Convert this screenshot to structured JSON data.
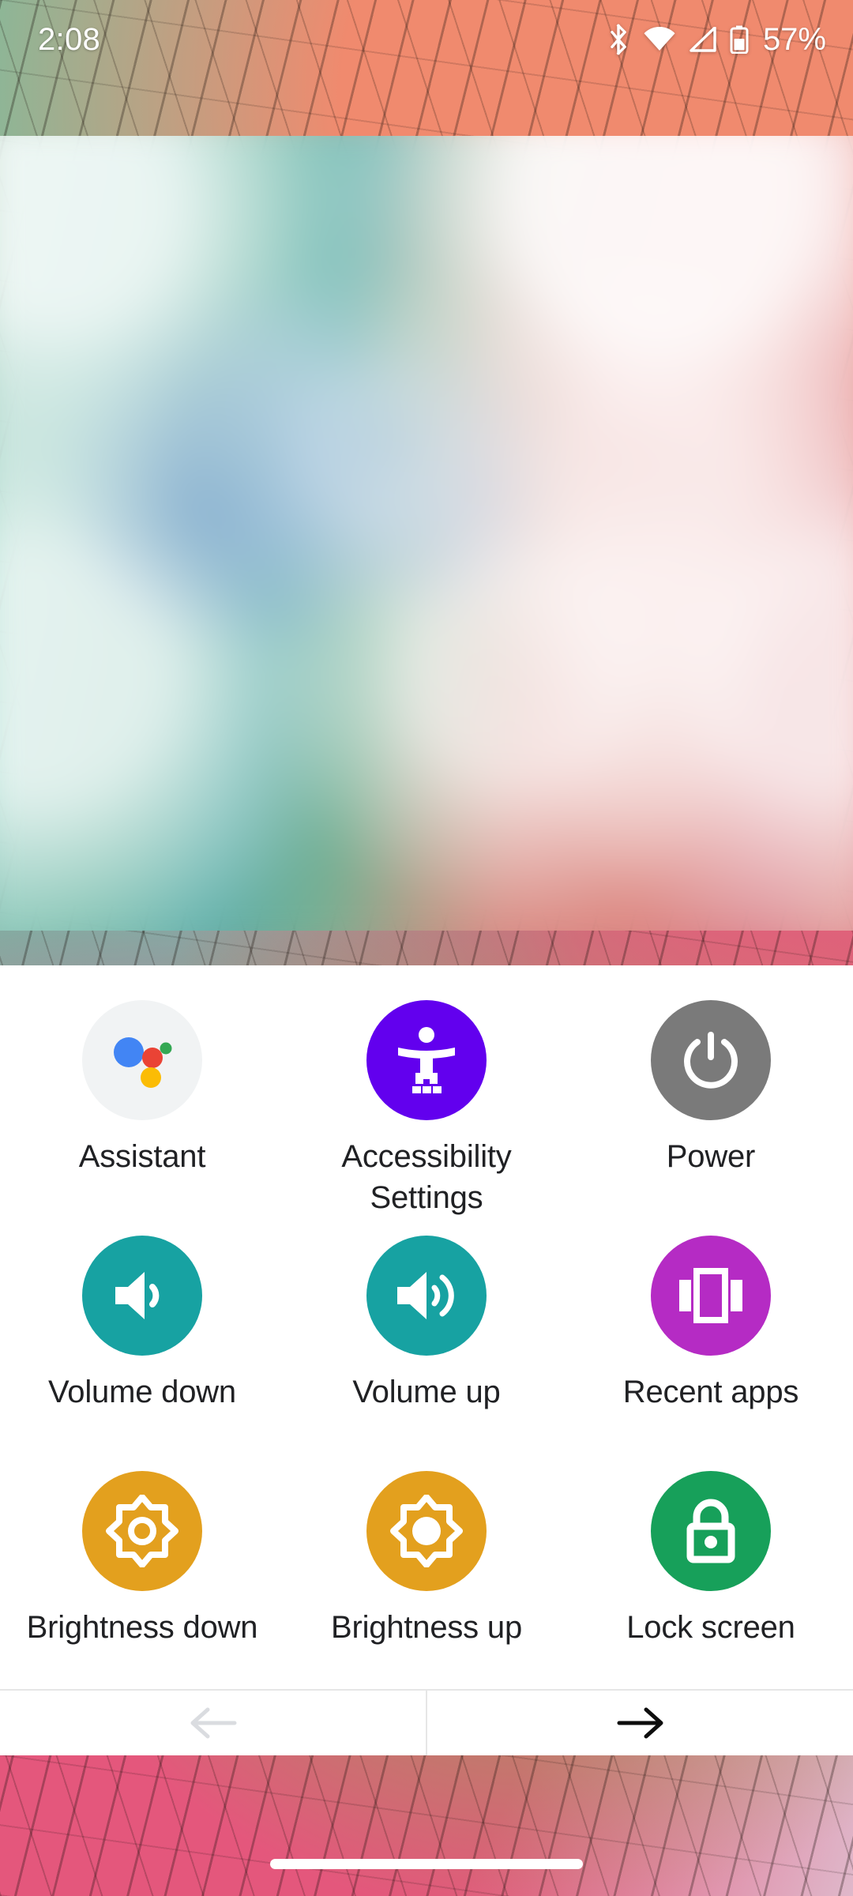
{
  "status_bar": {
    "time": "2:08",
    "battery_percent": "57%",
    "icons": [
      "bluetooth-icon",
      "wifi-icon",
      "cell-signal-icon",
      "battery-icon"
    ]
  },
  "menu": {
    "items": [
      {
        "label": "Assistant",
        "icon": "google-assistant-icon",
        "bg": "#f1f3f4"
      },
      {
        "label": "Accessibility Settings",
        "icon": "accessibility-person-icon",
        "bg": "#6200ee"
      },
      {
        "label": "Power",
        "icon": "power-icon",
        "bg": "#7a7a7a"
      },
      {
        "label": "Volume down",
        "icon": "volume-down-icon",
        "bg": "#17a2a2"
      },
      {
        "label": "Volume up",
        "icon": "volume-up-icon",
        "bg": "#17a2a2"
      },
      {
        "label": "Recent apps",
        "icon": "recent-apps-icon",
        "bg": "#b52bc4"
      },
      {
        "label": "Brightness down",
        "icon": "brightness-down-icon",
        "bg": "#e3a01e"
      },
      {
        "label": "Brightness up",
        "icon": "brightness-up-icon",
        "bg": "#e3a01e"
      },
      {
        "label": "Lock screen",
        "icon": "lock-icon",
        "bg": "#17a05a"
      }
    ]
  },
  "pagination": {
    "prev_icon": "arrow-left-icon",
    "next_icon": "arrow-right-icon",
    "prev_enabled_color": "#202124",
    "prev_disabled_color": "#dadce0",
    "next_color": "#0d0d0d"
  },
  "colors": {
    "assistant_blue": "#4285f4",
    "assistant_red": "#ea4335",
    "assistant_yellow": "#fbbc05",
    "assistant_green": "#34a853",
    "label_text": "#202124",
    "sheet_background": "#ffffff",
    "divider": "#e6e6e6"
  }
}
